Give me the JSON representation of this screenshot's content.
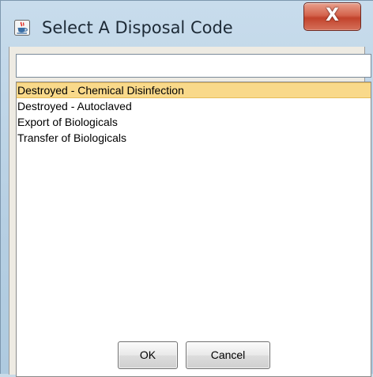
{
  "window": {
    "title": "Select A Disposal Code",
    "icon": "java-coffee-cup-icon",
    "close_label": "X",
    "close_color": "#c2432c"
  },
  "search": {
    "value": "",
    "placeholder": ""
  },
  "list": {
    "items": [
      {
        "label": "Destroyed - Chemical Disinfection",
        "selected": true
      },
      {
        "label": "Destroyed -  Autoclaved",
        "selected": false
      },
      {
        "label": "Export of Biologicals",
        "selected": false
      },
      {
        "label": "Transfer of Biologicals",
        "selected": false
      }
    ],
    "selection_color": "#f9d98a"
  },
  "buttons": {
    "ok_label": "OK",
    "cancel_label": "Cancel"
  }
}
